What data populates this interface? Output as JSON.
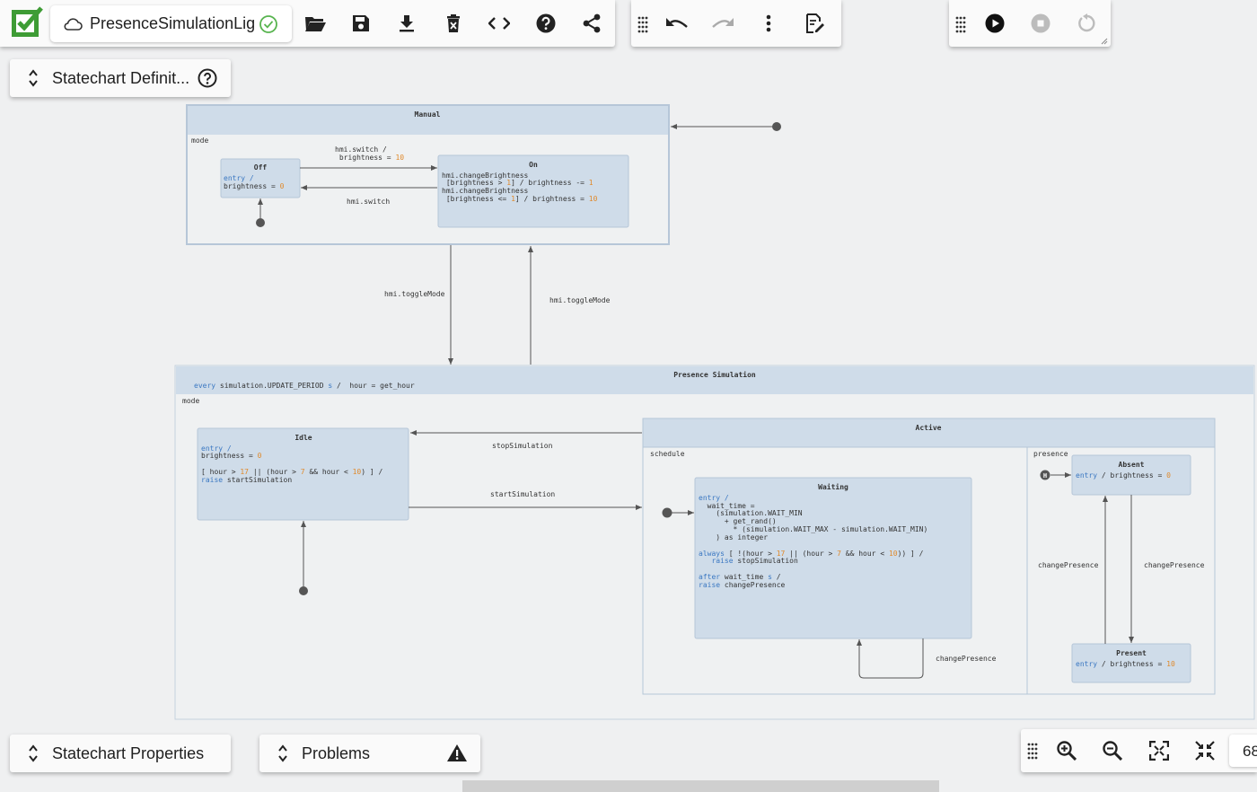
{
  "app": {
    "file_name": "PresenceSimulationLig",
    "definition_panel_label": "Statechart Definit...",
    "properties_panel_label": "Statechart Properties",
    "problems_panel_label": "Problems",
    "zoom_level": "68"
  },
  "toolbar": {
    "file_icons": [
      "open-folder-icon",
      "save-icon",
      "download-icon",
      "delete-file-icon",
      "code-icon",
      "help-icon",
      "share-icon"
    ],
    "edit_icons": [
      "undo-icon",
      "redo-icon",
      "more-vertical-icon",
      "edit-document-icon"
    ],
    "sim_icons": [
      "play-icon",
      "stop-icon",
      "restart-icon"
    ],
    "zoom_icons": [
      "zoom-in-icon",
      "zoom-out-icon",
      "fit-screen-icon",
      "collapse-icon"
    ]
  },
  "colors": {
    "accent_green": "#3e9c35",
    "state_fill": "#cfdce9",
    "region_fill": "#eff1f2",
    "keyword_blue": "#3b78c2",
    "number_orange": "#e08a2c"
  },
  "diagram": {
    "manual": {
      "title": "Manual",
      "region": "mode",
      "off": {
        "title": "Off",
        "entry": "entry /",
        "action_pre": "brightness = ",
        "action_num": "0"
      },
      "on": {
        "title": "On",
        "l1": "hmi.changeBrightness",
        "l2a": " [brightness > ",
        "l2b": "1",
        "l2c": "] / brightness -= ",
        "l2d": "1",
        "l3": "hmi.changeBrightness",
        "l4a": " [brightness <= ",
        "l4b": "1",
        "l4c": "] / brightness = ",
        "l4d": "10"
      },
      "t_switch_on_1": "hmi.switch /",
      "t_switch_on_2a": " brightness = ",
      "t_switch_on_2b": "10",
      "t_switch_off": "hmi.switch"
    },
    "toggle_down": "hmi.toggleMode",
    "toggle_up": "hmi.toggleMode",
    "presence": {
      "title": "Presence Simulation",
      "every_kw": "every",
      "every_mid": " simulation.UPDATE_PERIOD ",
      "every_s": "s",
      "every_tail": " /  hour = get_hour",
      "region": "mode",
      "idle": {
        "title": "Idle",
        "entry": "entry /",
        "b_pre": "brightness = ",
        "b_num": "0",
        "g_a": "[ hour > ",
        "g_b": "17",
        "g_c": " || (hour > ",
        "g_d": "7",
        "g_e": " && hour < ",
        "g_f": "10",
        "g_g": ") ] /",
        "raise_kw": "raise",
        "raise_tail": " startSimulation"
      },
      "t_stop": "stopSimulation",
      "t_start": "startSimulation",
      "active": {
        "title": "Active",
        "schedule": "schedule",
        "presence_region": "presence",
        "waiting": {
          "title": "Waiting",
          "e1": "entry /",
          "e2": "  wait_time =",
          "e3": "    (simulation.WAIT_MIN",
          "e4": "      + get_rand()",
          "e5": "        * (simulation.WAIT_MAX - simulation.WAIT_MIN)",
          "e6": "    ) as integer",
          "al_kw": "always",
          "al_a": " [ !(hour > ",
          "al_b": "17",
          "al_c": " || (hour > ",
          "al_d": "7",
          "al_e": " && hour < ",
          "al_f": "10",
          "al_g": ")) ] /",
          "r1_kw": "raise",
          "r1_tail": " stopSimulation",
          "af_kw": "after",
          "af_mid": " wait_time ",
          "af_s": "s",
          "af_tail": " /",
          "r2_kw": "raise",
          "r2_tail": " changePresence"
        },
        "t_self": "changePresence",
        "absent": {
          "title": "Absent",
          "entry_kw": "entry",
          "tail": " / brightness = ",
          "num": "0"
        },
        "present": {
          "title": "Present",
          "entry_kw": "entry",
          "tail": " / brightness = ",
          "num": "10"
        },
        "history_label": "H",
        "t_left": "changePresence",
        "t_right": "changePresence"
      }
    }
  }
}
